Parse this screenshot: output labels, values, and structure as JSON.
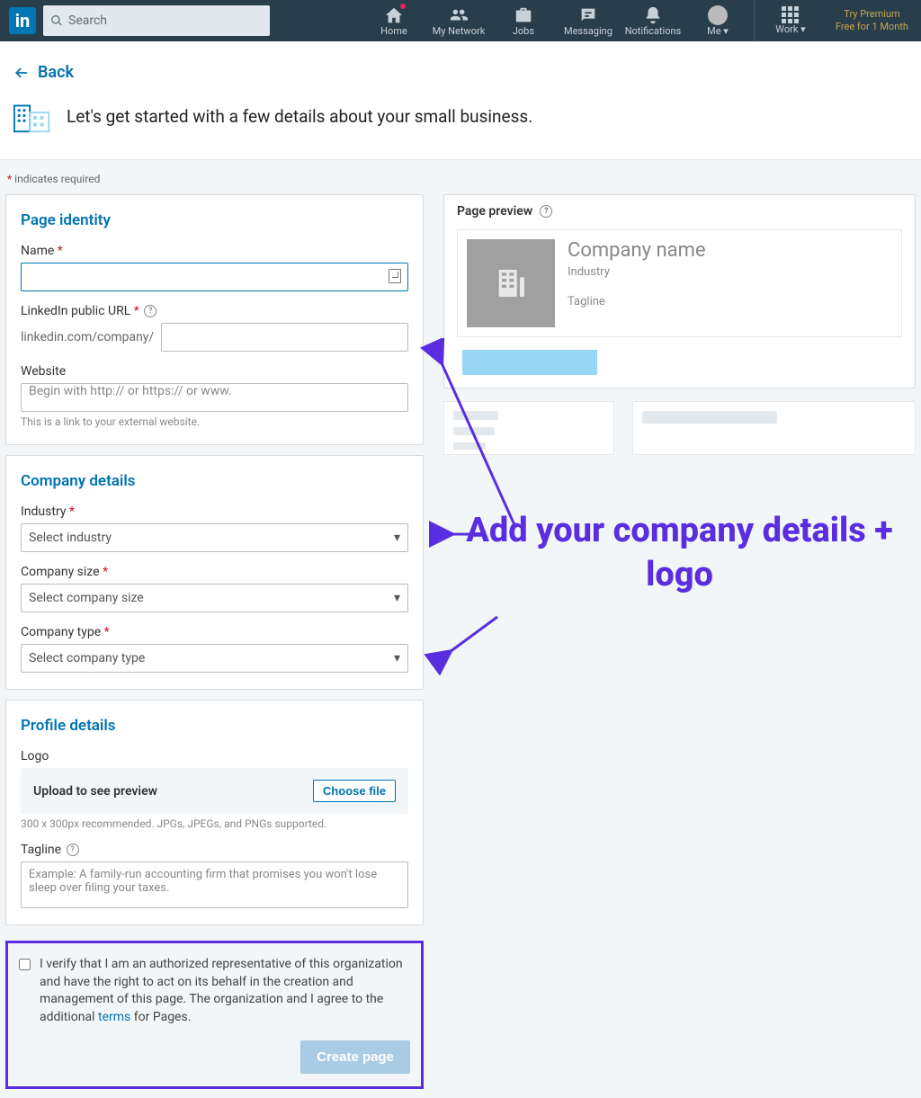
{
  "nav": {
    "search_placeholder": "Search",
    "items": [
      {
        "label": "Home"
      },
      {
        "label": "My Network"
      },
      {
        "label": "Jobs"
      },
      {
        "label": "Messaging"
      },
      {
        "label": "Notifications"
      },
      {
        "label": "Me ▾"
      },
      {
        "label": "Work ▾"
      }
    ],
    "premium_line1": "Try Premium",
    "premium_line2": "Free for 1 Month"
  },
  "back_label": "Back",
  "intro_text": "Let's get started with a few details about your small business.",
  "required_note": "indicates required",
  "sections": {
    "identity": {
      "title": "Page identity",
      "name_label": "Name",
      "url_label": "LinkedIn public URL",
      "url_prefix": "linkedin.com/company/",
      "website_label": "Website",
      "website_placeholder": "Begin with http:// or https:// or www.",
      "website_hint": "This is a link to your external website."
    },
    "company": {
      "title": "Company details",
      "industry_label": "Industry",
      "industry_placeholder": "Select industry",
      "size_label": "Company size",
      "size_placeholder": "Select company size",
      "type_label": "Company type",
      "type_placeholder": "Select company type"
    },
    "profile": {
      "title": "Profile details",
      "logo_label": "Logo",
      "upload_label": "Upload to see preview",
      "choose_file": "Choose file",
      "upload_hint": "300 x 300px recommended. JPGs, JPEGs, and PNGs supported.",
      "tagline_label": "Tagline",
      "tagline_placeholder": "Example: A family-run accounting firm that promises you won't lose sleep over filing your taxes."
    }
  },
  "verify": {
    "text_before": "I verify that I am an authorized representative of this organization and have the right to act on its behalf in the creation and management of this page. The organization and I agree to the additional ",
    "terms": "terms",
    "text_after": " for Pages.",
    "create_button": "Create page"
  },
  "preview": {
    "title": "Page preview",
    "company_name": "Company name",
    "industry": "Industry",
    "tagline": "Tagline"
  },
  "annotation": {
    "text": "Add your company details + logo"
  }
}
